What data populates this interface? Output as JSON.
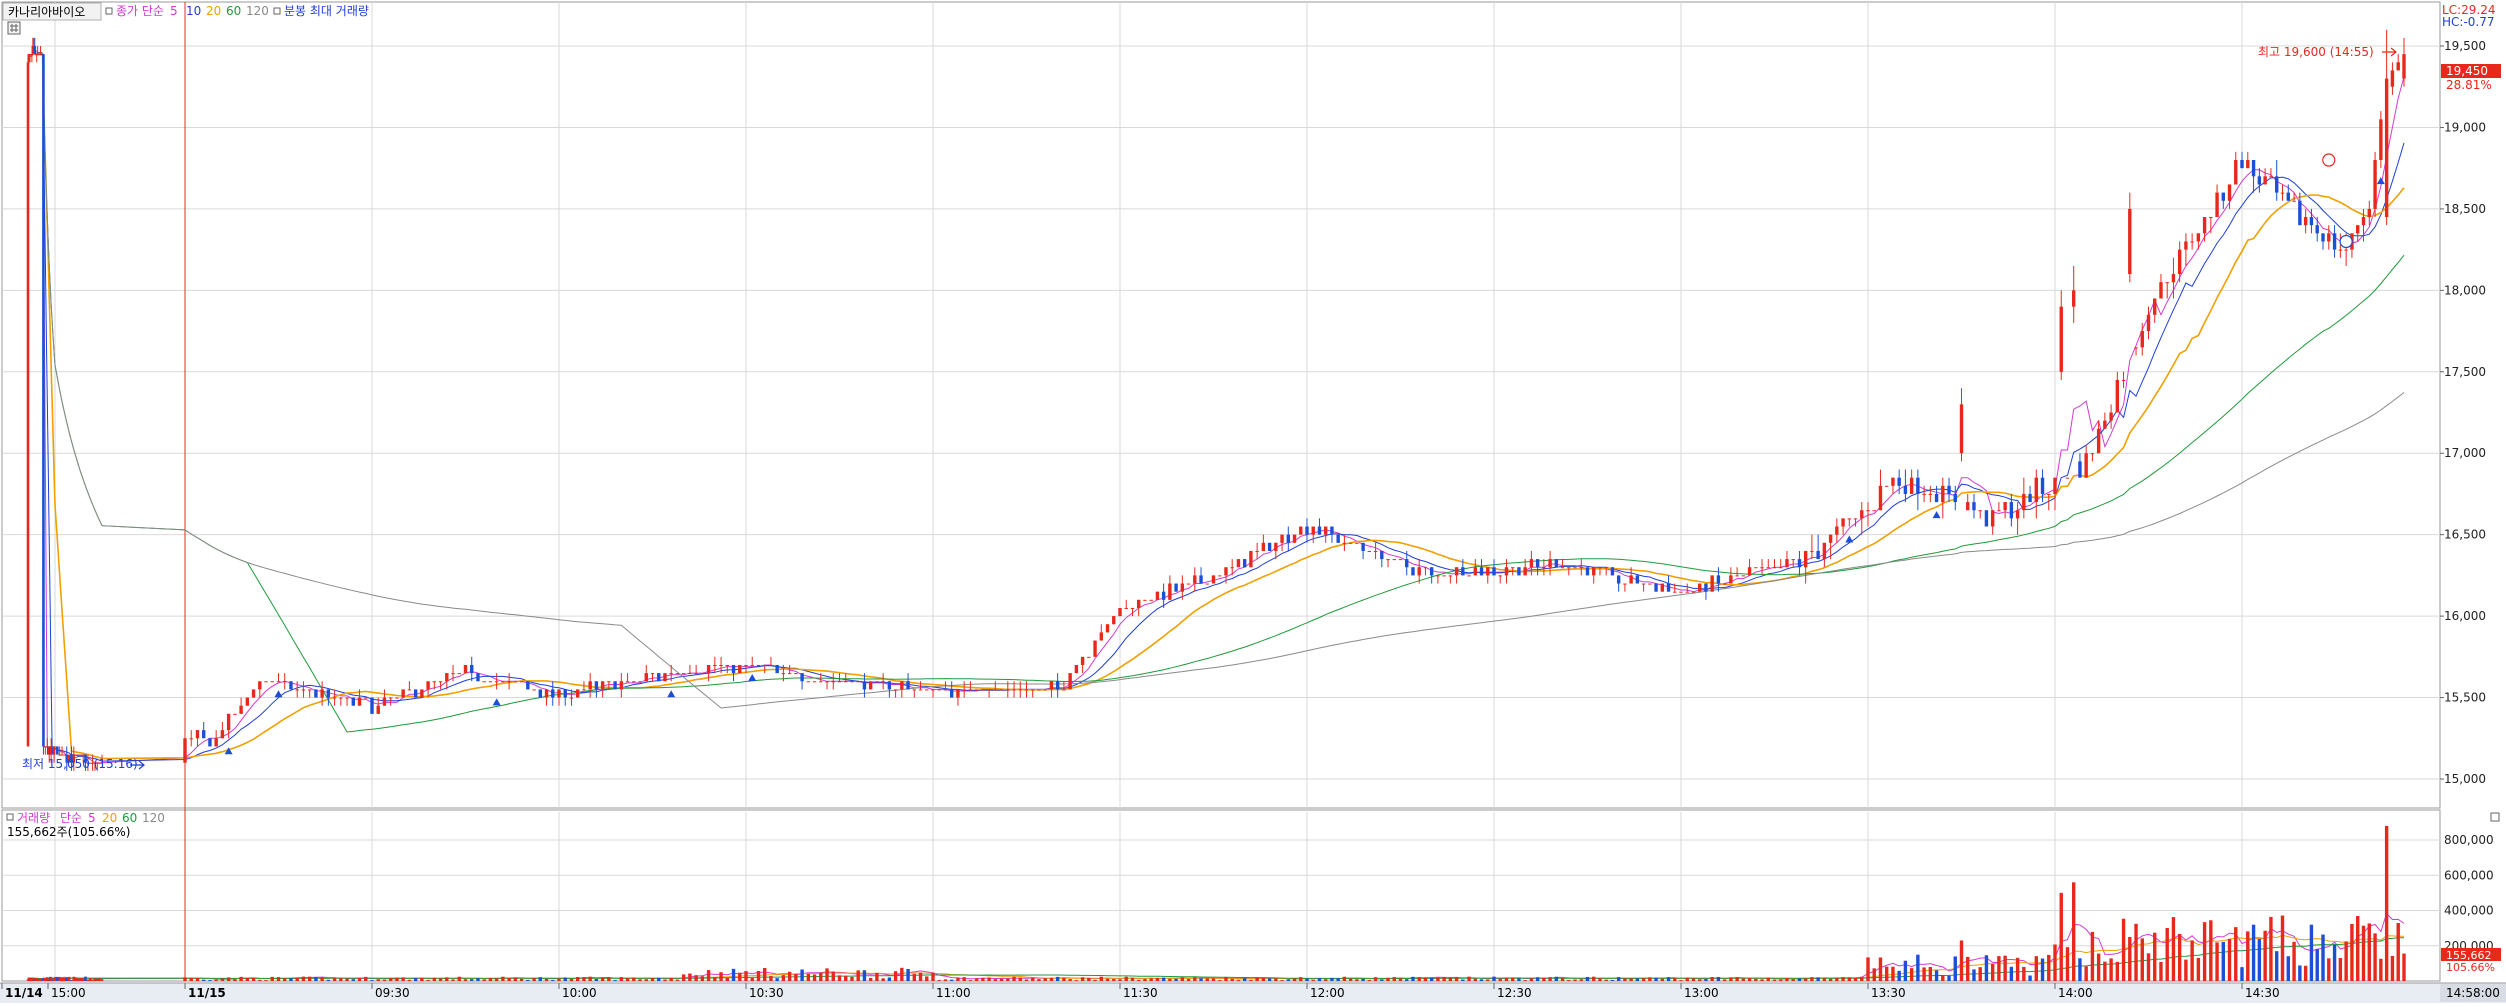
{
  "header": {
    "title": "카나리아바이오",
    "ma_label": "종가 단순",
    "ma_periods": [
      "5",
      "10",
      "20",
      "60",
      "120"
    ],
    "extra_label": "분봉 최대 거래량"
  },
  "corner": {
    "lc": "LC:29.24",
    "hc": "HC:-0.77"
  },
  "annotations": {
    "high": "최고 19,600 (14:55)",
    "low": "최저 15,050 (15:16)"
  },
  "price_label": {
    "price": "19,450",
    "change": "28.81%"
  },
  "volume_panel": {
    "title": "거래량",
    "ma_label": "단순",
    "ma_periods": [
      "5",
      "20",
      "60",
      "120"
    ],
    "last_value": "155,662주(105.66%)",
    "badge_value": "155,662",
    "badge_pct": "105.66%"
  },
  "x_axis": {
    "labels": [
      {
        "t": "11/14",
        "bold": true
      },
      {
        "t": "15:00",
        "bold": false
      },
      {
        "t": "11/15",
        "bold": true
      },
      {
        "t": "09:30",
        "bold": false
      },
      {
        "t": "10:00",
        "bold": false
      },
      {
        "t": "10:30",
        "bold": false
      },
      {
        "t": "11:00",
        "bold": false
      },
      {
        "t": "11:30",
        "bold": false
      },
      {
        "t": "12:00",
        "bold": false
      },
      {
        "t": "12:30",
        "bold": false
      },
      {
        "t": "13:00",
        "bold": false
      },
      {
        "t": "13:30",
        "bold": false
      },
      {
        "t": "14:00",
        "bold": false
      },
      {
        "t": "14:30",
        "bold": false
      }
    ],
    "current_time": "14:58:00"
  },
  "colors": {
    "up": "#e8281c",
    "down": "#1c4fd6",
    "ma5": "#d23ad2",
    "ma10": "#1f3fd6",
    "ma20": "#f0a000",
    "ma60": "#1f9a3a",
    "ma120": "#8a8a8a",
    "grid": "#d9d9d9",
    "session_line": "#e8281c"
  },
  "chart_data": {
    "type": "candlestick",
    "title": "카나리아바이오",
    "interval": "1-minute",
    "y_axis_ticks": [
      15000,
      15500,
      16000,
      16500,
      17000,
      17500,
      18000,
      18500,
      19000,
      19500
    ],
    "y_axis_labels": [
      "15,000",
      "15,500",
      "16,000",
      "16,500",
      "17,000",
      "17,500",
      "18,000",
      "18,500",
      "19,000",
      "19,500"
    ],
    "ylim": [
      14650,
      19800
    ],
    "volume_axis_ticks": [
      200000,
      400000,
      600000,
      800000
    ],
    "volume_axis_labels": [
      "200,000",
      "400,000",
      "600,000",
      "800,000"
    ],
    "volume_ylim": [
      0,
      900000
    ],
    "high": {
      "price": 19600,
      "time": "14:55"
    },
    "low": {
      "price": 15050,
      "time": "15:16"
    },
    "last_close": 19450,
    "change_pct": 28.81,
    "last_volume": 155662,
    "time_axis": [
      "11/14",
      "15:00",
      "11/15",
      "09:30",
      "10:00",
      "10:30",
      "11:00",
      "11:30",
      "12:00",
      "12:30",
      "13:00",
      "13:30",
      "14:00",
      "14:30"
    ],
    "price_path_keypoints": [
      {
        "time": "11/14 14:48",
        "close": 15200
      },
      {
        "time": "11/14 15:16",
        "close": 15100
      },
      {
        "time": "11/15 09:05",
        "close": 15250
      },
      {
        "time": "11/15 09:12",
        "close": 15600
      },
      {
        "time": "11/15 09:30",
        "close": 15450
      },
      {
        "time": "11/15 09:45",
        "close": 15650
      },
      {
        "time": "11/15 10:00",
        "close": 15520
      },
      {
        "time": "11/15 10:25",
        "close": 15700
      },
      {
        "time": "11/15 11:00",
        "close": 15550
      },
      {
        "time": "11/15 11:20",
        "close": 15550
      },
      {
        "time": "11/15 11:30",
        "close": 16050
      },
      {
        "time": "11/15 11:45",
        "close": 16250
      },
      {
        "time": "11/15 12:00",
        "close": 16550
      },
      {
        "time": "11/15 12:20",
        "close": 16250
      },
      {
        "time": "11/15 12:40",
        "close": 16320
      },
      {
        "time": "11/15 13:00",
        "close": 16150
      },
      {
        "time": "11/15 13:20",
        "close": 16350
      },
      {
        "time": "11/15 13:35",
        "close": 16850
      },
      {
        "time": "11/15 13:50",
        "close": 16600
      },
      {
        "time": "11/15 14:05",
        "close": 16950
      },
      {
        "time": "11/15 14:15",
        "close": 17900
      },
      {
        "time": "11/15 14:30",
        "close": 18800
      },
      {
        "time": "11/15 14:40",
        "close": 18450
      },
      {
        "time": "11/15 14:48",
        "close": 18250
      },
      {
        "time": "11/15 14:52",
        "close": 18550
      },
      {
        "time": "11/15 14:55",
        "close": 19300
      },
      {
        "time": "11/15 14:58",
        "close": 19450
      }
    ],
    "moving_averages": [
      "5",
      "10",
      "20",
      "60",
      "120"
    ]
  }
}
